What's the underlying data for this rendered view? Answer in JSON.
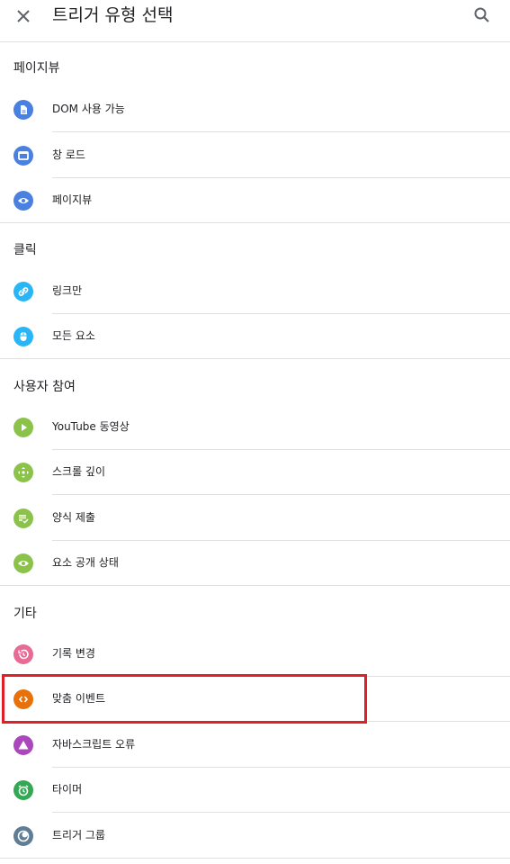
{
  "header": {
    "title": "트리거 유형 선택"
  },
  "sections": [
    {
      "title": "페이지뷰",
      "items": [
        {
          "label": "DOM 사용 가능",
          "icon": "document-icon",
          "color": "#4a80e0"
        },
        {
          "label": "창 로드",
          "icon": "window-icon",
          "color": "#4a80e0"
        },
        {
          "label": "페이지뷰",
          "icon": "eye-icon",
          "color": "#4a80e0"
        }
      ]
    },
    {
      "title": "클릭",
      "items": [
        {
          "label": "링크만",
          "icon": "link-icon",
          "color": "#29b6f6"
        },
        {
          "label": "모든 요소",
          "icon": "mouse-icon",
          "color": "#29b6f6"
        }
      ]
    },
    {
      "title": "사용자 참여",
      "items": [
        {
          "label": "YouTube 동영상",
          "icon": "play-icon",
          "color": "#8bc34a"
        },
        {
          "label": "스크롤 깊이",
          "icon": "scroll-arrows-icon",
          "color": "#8bc34a"
        },
        {
          "label": "양식 제출",
          "icon": "form-check-icon",
          "color": "#8bc34a"
        },
        {
          "label": "요소 공개 상태",
          "icon": "eye-icon",
          "color": "#8bc34a"
        }
      ]
    },
    {
      "title": "기타",
      "items": [
        {
          "label": "기록 변경",
          "icon": "history-icon",
          "color": "#e86b95"
        },
        {
          "label": "맞춤 이벤트",
          "icon": "code-icon",
          "color": "#e8710a"
        },
        {
          "label": "자바스크립트 오류",
          "icon": "warning-triangle-icon",
          "color": "#ab47bc"
        },
        {
          "label": "타이머",
          "icon": "alarm-clock-icon",
          "color": "#34a853"
        },
        {
          "label": "트리거 그룹",
          "icon": "group-circles-icon",
          "color": "#5f7d95"
        }
      ]
    }
  ],
  "highlight_color": "#e02028"
}
